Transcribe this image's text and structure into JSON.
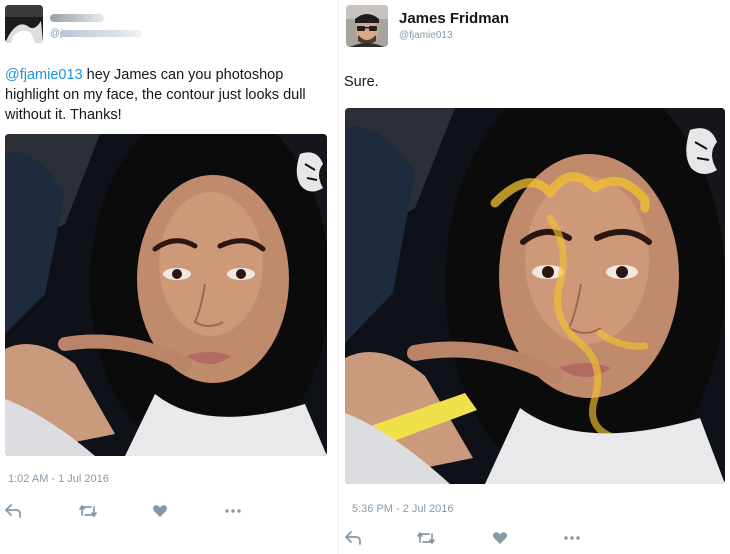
{
  "colors": {
    "mention": "#1b95e0",
    "meta": "#8899a6",
    "text": "#14171a",
    "highlighter": "#f2c12e"
  },
  "left_tweet": {
    "author_name": "",
    "author_handle": "@j",
    "mention": "@fjamie013",
    "text": "hey James can you photoshop highlight on my face, the contour just looks dull without it. Thanks!",
    "timestamp": "1:02 AM - 1 Jul 2016",
    "actions": [
      "reply-icon",
      "retweet-icon",
      "like-icon",
      "more-icon"
    ]
  },
  "right_tweet": {
    "author_name": "James Fridman",
    "author_handle": "@fjamie013",
    "text": "Sure.",
    "timestamp": "5:36 PM - 2 Jul 2016",
    "actions": [
      "reply-icon",
      "retweet-icon",
      "like-icon",
      "more-icon"
    ]
  }
}
